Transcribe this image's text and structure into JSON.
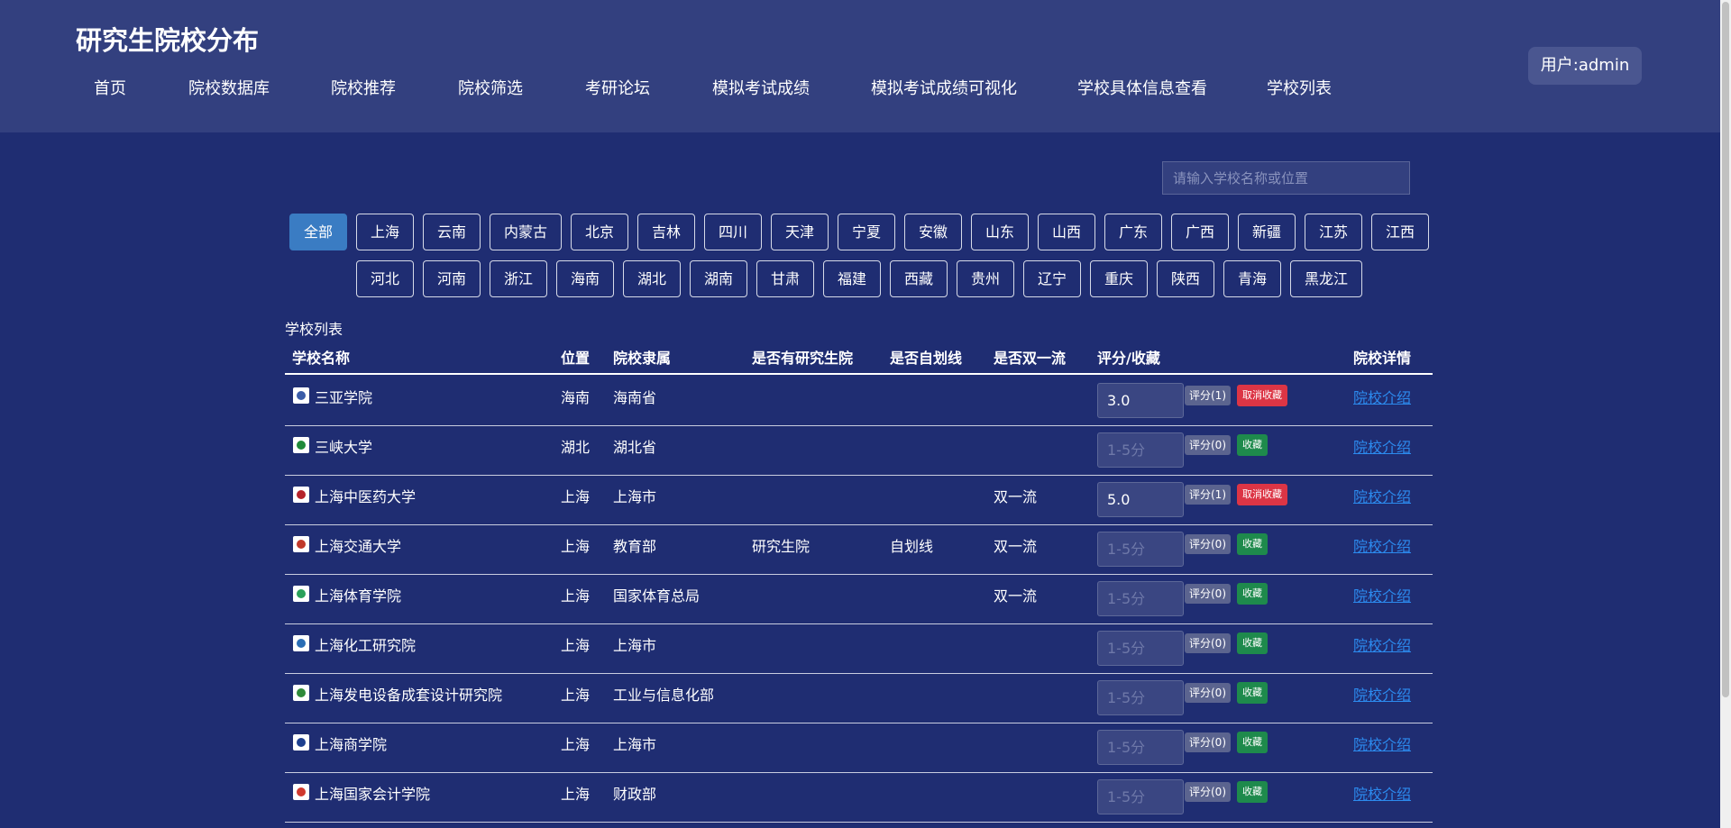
{
  "header": {
    "title": "研究生院校分布",
    "nav": [
      "首页",
      "院校数据库",
      "院校推荐",
      "院校筛选",
      "考研论坛",
      "模拟考试成绩",
      "模拟考试成绩可视化",
      "学校具体信息查看",
      "学校列表"
    ],
    "user": "用户:admin"
  },
  "search": {
    "placeholder": "请输入学校名称或位置"
  },
  "regions": {
    "active": "全部",
    "row1": [
      "全部",
      "上海",
      "云南",
      "内蒙古",
      "北京",
      "吉林",
      "四川",
      "天津",
      "宁夏",
      "安徽",
      "山东",
      "山西",
      "广东",
      "广西",
      "新疆",
      "江苏",
      "江西"
    ],
    "row2": [
      "河北",
      "河南",
      "浙江",
      "海南",
      "湖北",
      "湖南",
      "甘肃",
      "福建",
      "西藏",
      "贵州",
      "辽宁",
      "重庆",
      "陕西",
      "青海",
      "黑龙江"
    ]
  },
  "table": {
    "caption": "学校列表",
    "headers": [
      "学校名称",
      "位置",
      "院校隶属",
      "是否有研究生院",
      "是否自划线",
      "是否双一流",
      "评分/收藏",
      "院校详情"
    ],
    "score_placeholder": "1-5分",
    "detail_label": "院校介绍",
    "collect_label": "收藏",
    "uncollect_label": "取消收藏",
    "rows": [
      {
        "name": "三亚学院",
        "location": "海南",
        "affiliation": "海南省",
        "grad_school": "",
        "self_line": "",
        "double_first": "",
        "score": "3.0",
        "rate": "评分(1)",
        "favorited": true,
        "logo_color": "#3b5ca8"
      },
      {
        "name": "三峡大学",
        "location": "湖北",
        "affiliation": "湖北省",
        "grad_school": "",
        "self_line": "",
        "double_first": "",
        "score": "",
        "rate": "评分(0)",
        "favorited": false,
        "logo_color": "#1f8a3a"
      },
      {
        "name": "上海中医药大学",
        "location": "上海",
        "affiliation": "上海市",
        "grad_school": "",
        "self_line": "",
        "double_first": "双一流",
        "score": "5.0",
        "rate": "评分(1)",
        "favorited": true,
        "logo_color": "#b5232b"
      },
      {
        "name": "上海交通大学",
        "location": "上海",
        "affiliation": "教育部",
        "grad_school": "研究生院",
        "self_line": "自划线",
        "double_first": "双一流",
        "score": "",
        "rate": "评分(0)",
        "favorited": false,
        "logo_color": "#c0392b"
      },
      {
        "name": "上海体育学院",
        "location": "上海",
        "affiliation": "国家体育总局",
        "grad_school": "",
        "self_line": "",
        "double_first": "双一流",
        "score": "",
        "rate": "评分(0)",
        "favorited": false,
        "logo_color": "#2aa05a"
      },
      {
        "name": "上海化工研究院",
        "location": "上海",
        "affiliation": "上海市",
        "grad_school": "",
        "self_line": "",
        "double_first": "",
        "score": "",
        "rate": "评分(0)",
        "favorited": false,
        "logo_color": "#2a6db5"
      },
      {
        "name": "上海发电设备成套设计研究院",
        "location": "上海",
        "affiliation": "工业与信息化部",
        "grad_school": "",
        "self_line": "",
        "double_first": "",
        "score": "",
        "rate": "评分(0)",
        "favorited": false,
        "logo_color": "#2f8a3a"
      },
      {
        "name": "上海商学院",
        "location": "上海",
        "affiliation": "上海市",
        "grad_school": "",
        "self_line": "",
        "double_first": "",
        "score": "",
        "rate": "评分(0)",
        "favorited": false,
        "logo_color": "#1d3f8f"
      },
      {
        "name": "上海国家会计学院",
        "location": "上海",
        "affiliation": "财政部",
        "grad_school": "",
        "self_line": "",
        "double_first": "",
        "score": "",
        "rate": "评分(0)",
        "favorited": false,
        "logo_color": "#d0392f"
      }
    ]
  }
}
